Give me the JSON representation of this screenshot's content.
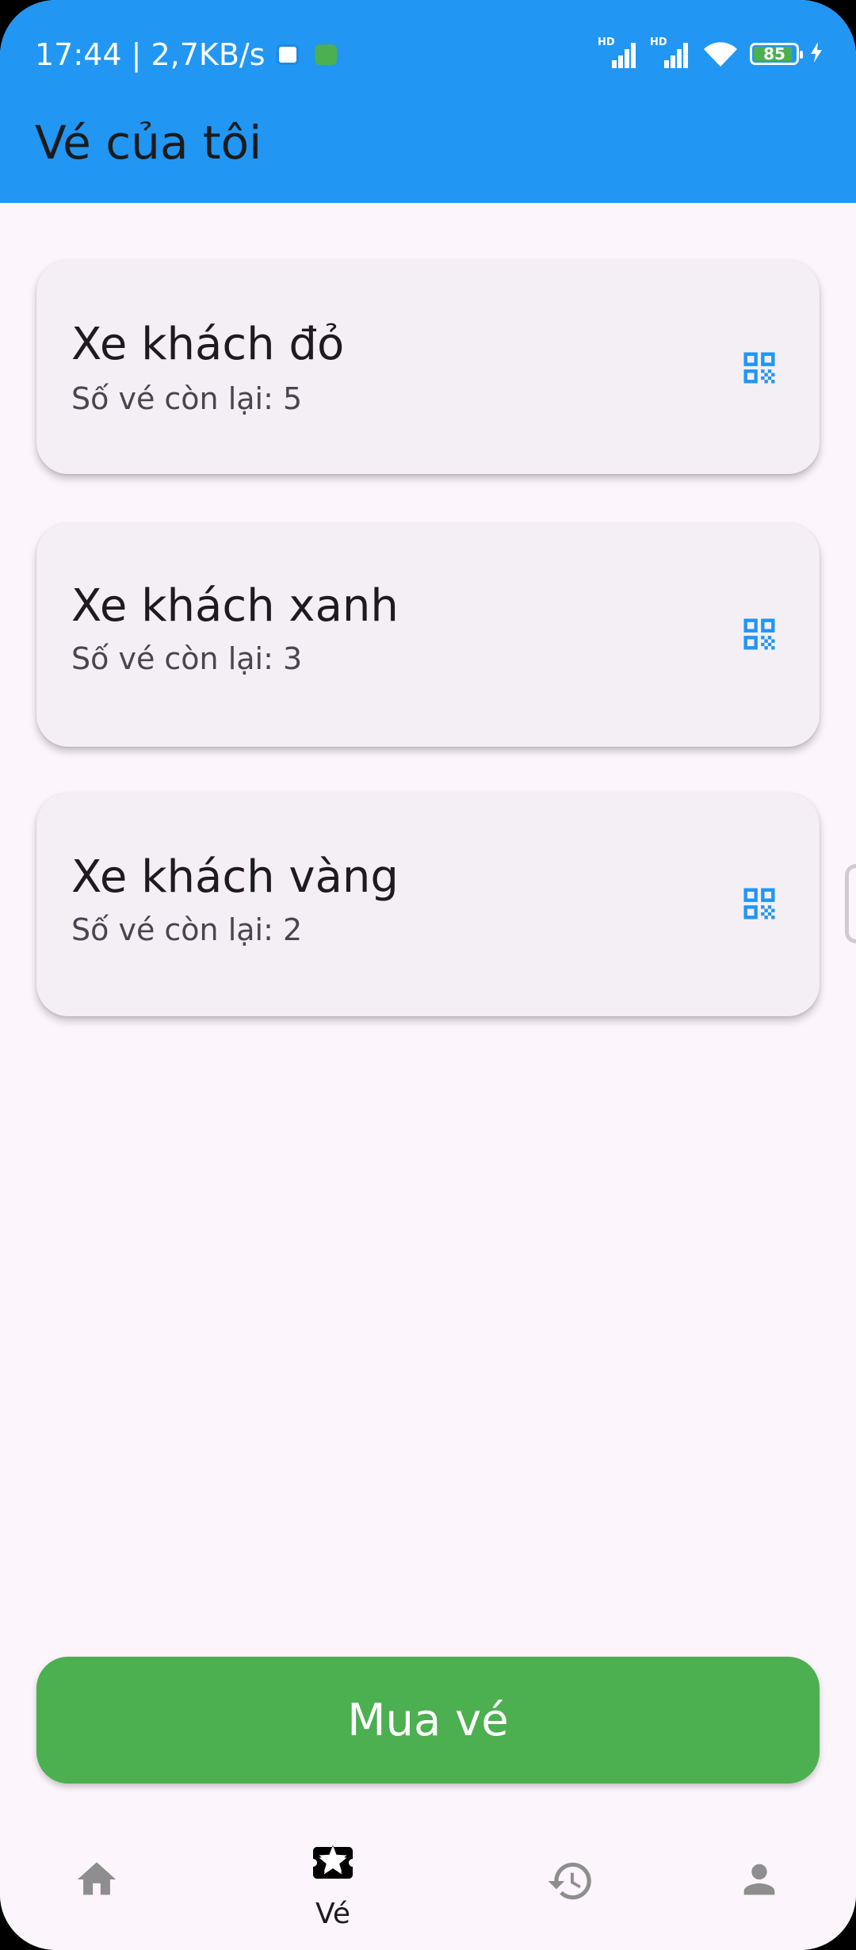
{
  "status_bar": {
    "time_speed": "17:44 | 2,7KB/s",
    "signal_badge": "HD",
    "battery_level": "85"
  },
  "app_bar": {
    "title": "Vé của tôi"
  },
  "tickets": [
    {
      "name": "Xe khách đỏ",
      "remaining": "Số vé còn lại: 5"
    },
    {
      "name": "Xe khách xanh",
      "remaining": "Số vé còn lại: 3"
    },
    {
      "name": "Xe khách vàng",
      "remaining": "Số vé còn lại: 2"
    }
  ],
  "buy_button": {
    "label": "Mua vé"
  },
  "bottom_nav": {
    "items": [
      {
        "icon": "home-icon",
        "label": ""
      },
      {
        "icon": "ticket-icon",
        "label": "Vé"
      },
      {
        "icon": "history-icon",
        "label": ""
      },
      {
        "icon": "person-icon",
        "label": ""
      }
    ],
    "active_index": 1
  },
  "colors": {
    "primary": "#2196F3",
    "buy": "#4CAF50",
    "background": "#FCF6FC",
    "card": "#F4EFF4",
    "nav_inactive": "#8e8e8e"
  }
}
